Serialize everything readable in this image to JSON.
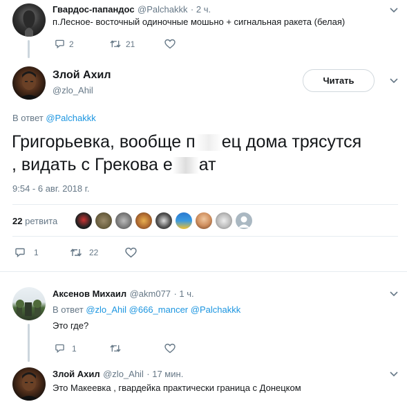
{
  "tweet1": {
    "name": "Гвардос-папандос",
    "handle": "@Palchakkk",
    "time": "· 2 ч.",
    "text": "п.Лесное- восточный одиночные мошьно + сигнальная ракета (белая)",
    "reply_count": "2",
    "retweet_count": "21"
  },
  "main": {
    "name": "Злой Ахил",
    "handle": "@zlo_Ahil",
    "follow_label": "Читать",
    "reply_prefix": "В ответ ",
    "reply_to": "@Palchakkk",
    "text_line1_a": "Григорьевка, вообще п",
    "text_line1_b": "ец дома трясутся",
    "text_line2_a": ", видать с Грекова е",
    "text_line2_b": "ат",
    "timestamp": "9:54 - 6 авг. 2018 г.",
    "retweets_count": "22",
    "retweets_label": "ретвита",
    "reply_count": "1",
    "retweet_count": "22"
  },
  "reply1": {
    "name": "Аксенов Михаил",
    "handle": "@akm077",
    "time": "· 1 ч.",
    "reply_prefix": "В ответ ",
    "reply_to_1": "@zlo_Ahil",
    "reply_to_2": "@666_mancer",
    "reply_to_3": "@Palchakkk",
    "text": "Это где?",
    "reply_count": "1"
  },
  "reply2": {
    "name": "Злой Ахил",
    "handle": "@zlo_Ahil",
    "time": "· 17 мин.",
    "text": "Это Макеевка , гвардейка практически граница с Донецком"
  },
  "icons": {
    "reply": "reply-icon",
    "retweet": "retweet-icon",
    "like": "heart-icon",
    "more": "chevron-down-icon"
  },
  "colors": {
    "link": "#1b95e0",
    "muted": "#657786",
    "text": "#14171a"
  }
}
